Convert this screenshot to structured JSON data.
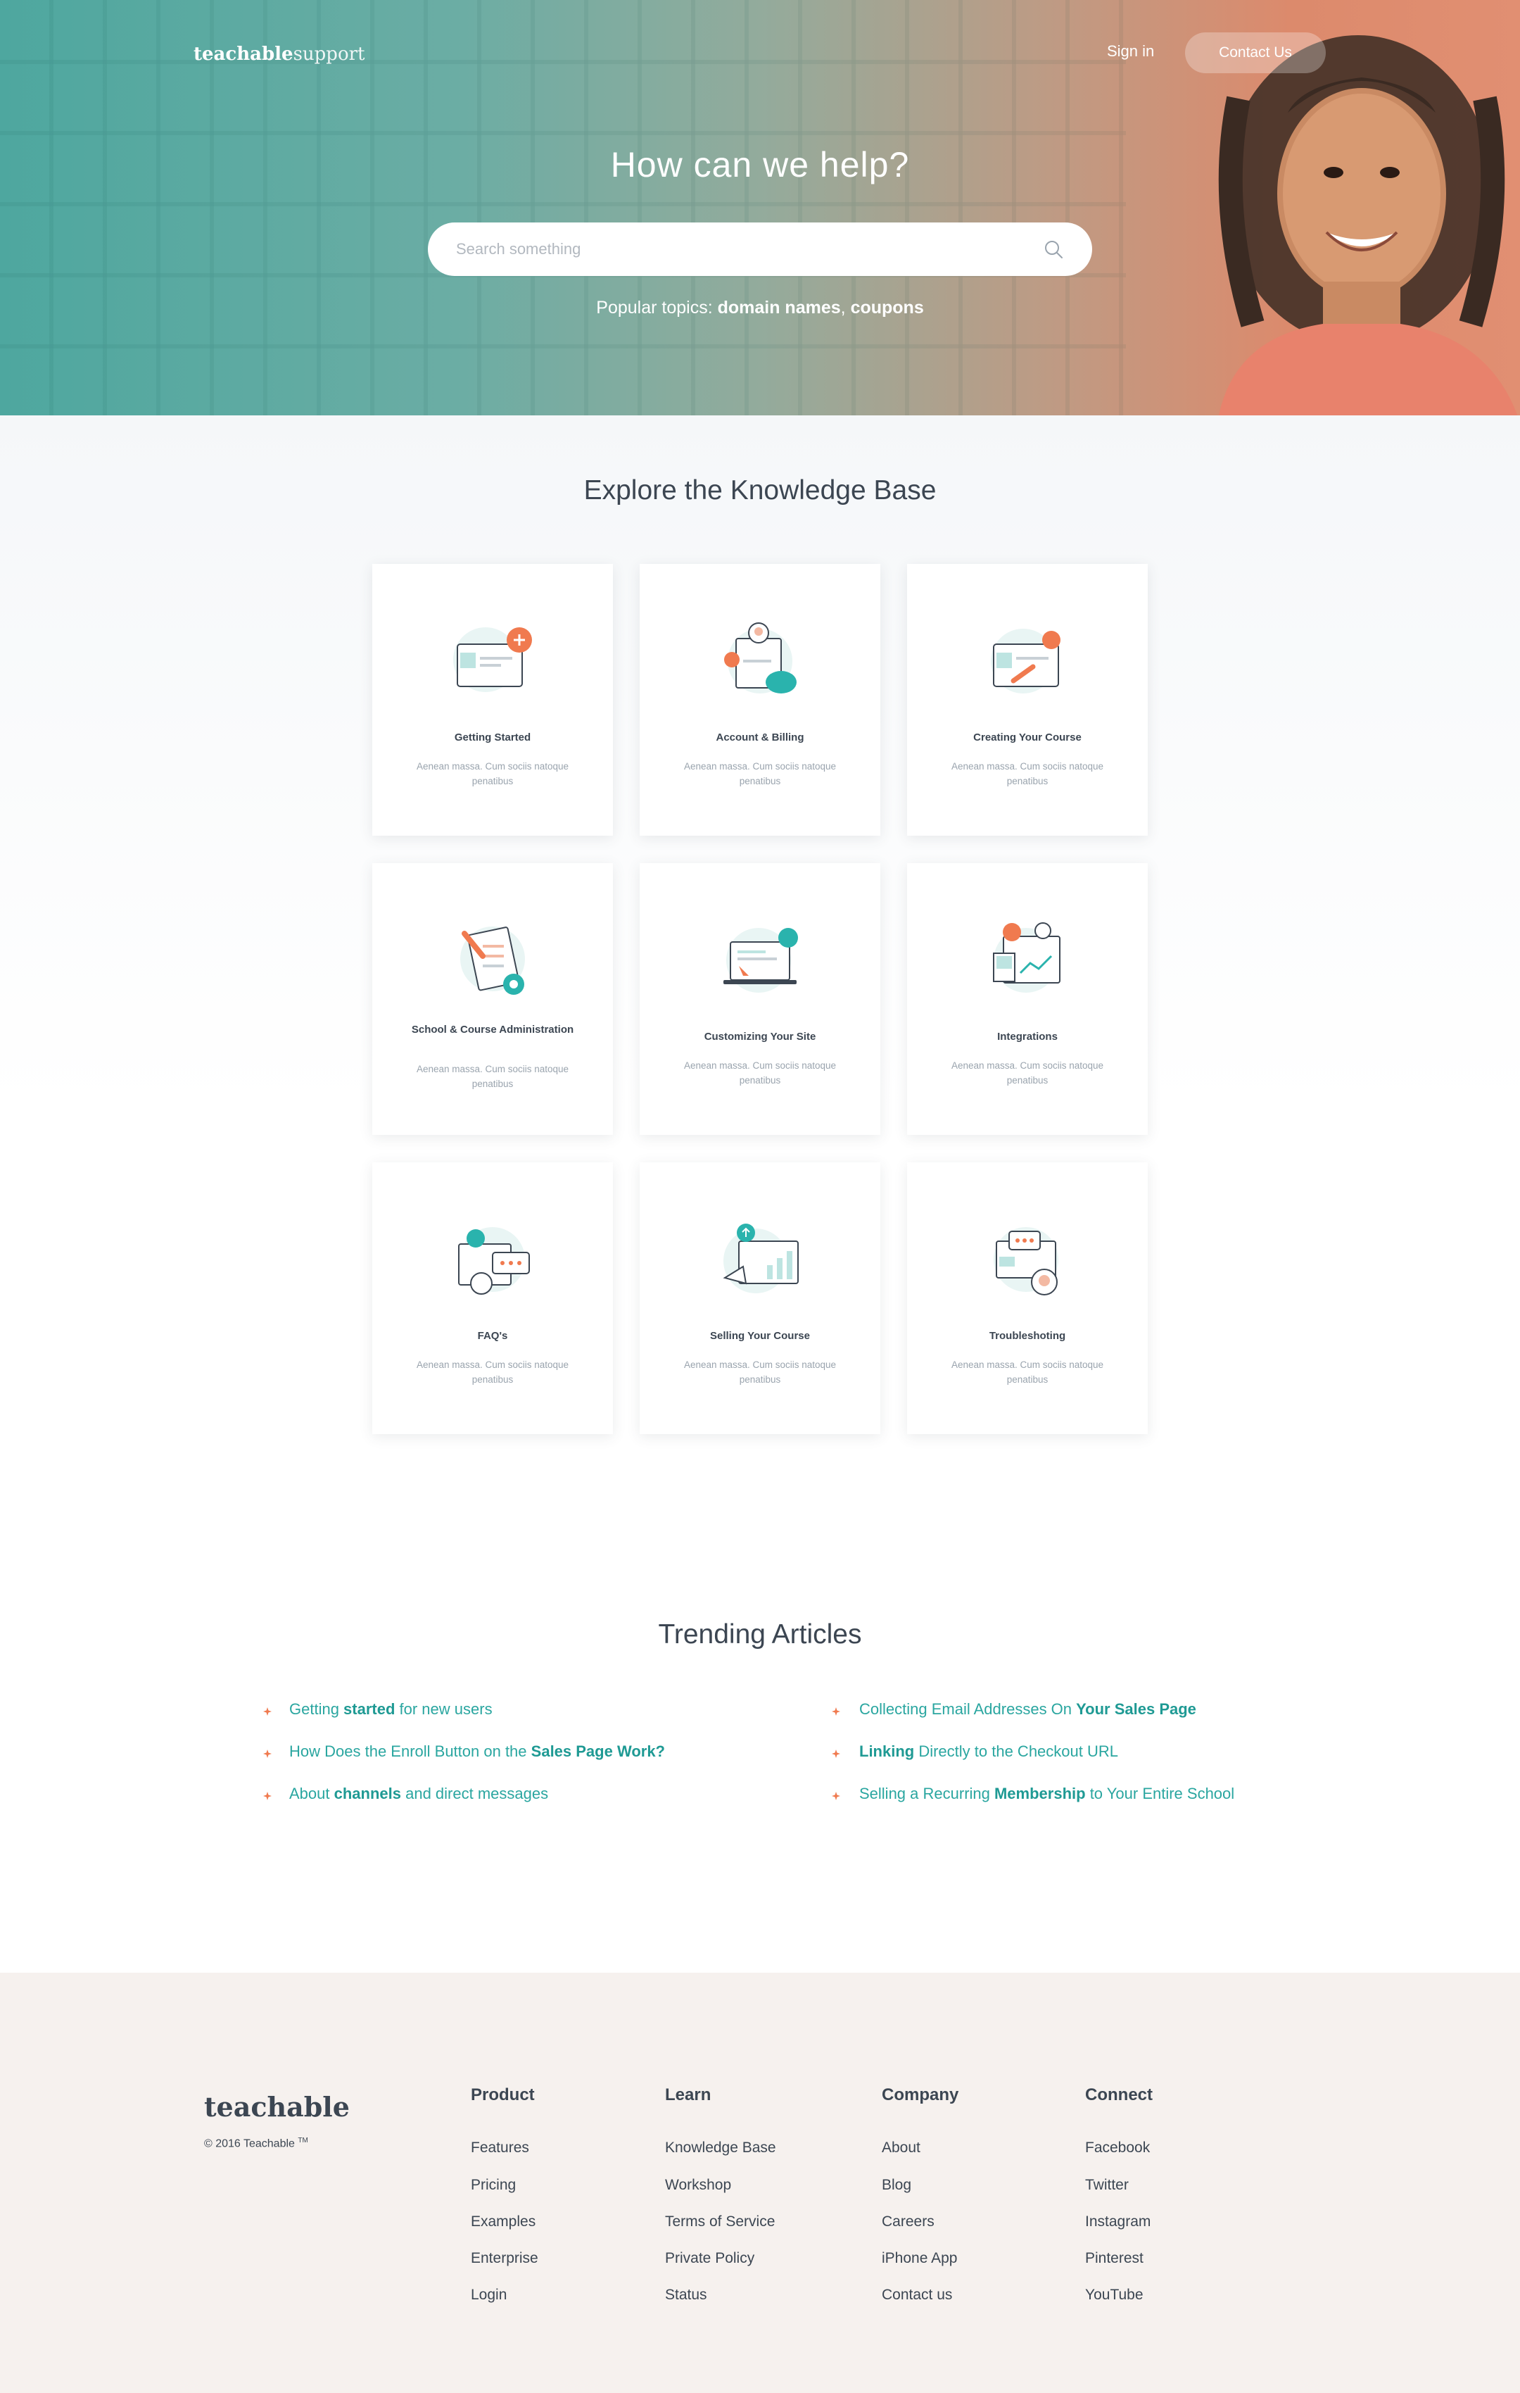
{
  "header": {
    "logo_bold": "teachable",
    "logo_light": "support",
    "signin_label": "Sign in",
    "contact_label": "Contact Us"
  },
  "hero": {
    "title": "How can we help?",
    "search_placeholder": "Search something",
    "popular_prefix": "Popular topics:",
    "popular_topics": [
      "domain names",
      "coupons"
    ]
  },
  "knowledge_base": {
    "title": "Explore the Knowledge Base",
    "cards": [
      {
        "title": "Getting Started",
        "desc": "Aenean massa. Cum sociis natoque penatibus"
      },
      {
        "title": "Account & Billing",
        "desc": "Aenean massa. Cum sociis natoque penatibus"
      },
      {
        "title": "Creating Your Course",
        "desc": "Aenean massa. Cum sociis natoque penatibus"
      },
      {
        "title": "School & Course Administration",
        "desc": "Aenean massa. Cum sociis natoque penatibus"
      },
      {
        "title": "Customizing Your Site",
        "desc": "Aenean massa. Cum sociis natoque penatibus"
      },
      {
        "title": "Integrations",
        "desc": "Aenean massa. Cum sociis natoque penatibus"
      },
      {
        "title": "FAQ's",
        "desc": "Aenean massa. Cum sociis natoque penatibus"
      },
      {
        "title": "Selling Your Course",
        "desc": "Aenean massa. Cum sociis natoque penatibus"
      },
      {
        "title": "Troubleshoting",
        "desc": "Aenean massa. Cum sociis natoque penatibus"
      }
    ]
  },
  "trending": {
    "title": "Trending Articles",
    "left": [
      {
        "pre": "Getting ",
        "bold": "started",
        "post": " for new users"
      },
      {
        "pre": "How Does the Enroll Button on the ",
        "bold": "Sales Page Work?",
        "post": ""
      },
      {
        "pre": "About ",
        "bold": "channels",
        "post": " and direct messages"
      }
    ],
    "right": [
      {
        "pre": "Collecting Email Addresses On ",
        "bold": "Your Sales Page",
        "post": ""
      },
      {
        "pre": "",
        "bold": "Linking",
        "post": " Directly to the Checkout URL"
      },
      {
        "pre": "Selling a Recurring ",
        "bold": "Membership",
        "post": " to Your Entire School"
      }
    ]
  },
  "footer": {
    "logo": "teachable",
    "copyright": "© 2016 Teachable",
    "tm": "TM",
    "columns": [
      {
        "heading": "Product",
        "links": [
          "Features",
          "Pricing",
          "Examples",
          "Enterprise",
          "Login"
        ]
      },
      {
        "heading": "Learn",
        "links": [
          "Knowledge Base",
          "Workshop",
          "Terms of Service",
          "Private Policy",
          "Status"
        ]
      },
      {
        "heading": "Company",
        "links": [
          "About",
          "Blog",
          "Careers",
          "iPhone App",
          "Contact us"
        ]
      },
      {
        "heading": "Connect",
        "links": [
          "Facebook",
          "Twitter",
          "Instagram",
          "Pinterest",
          "YouTube"
        ]
      }
    ]
  },
  "colors": {
    "accent_teal": "#2aa6a0",
    "accent_orange": "#f07a4f",
    "text_dark": "#3c4652",
    "footer_bg": "#f6f1ee"
  }
}
